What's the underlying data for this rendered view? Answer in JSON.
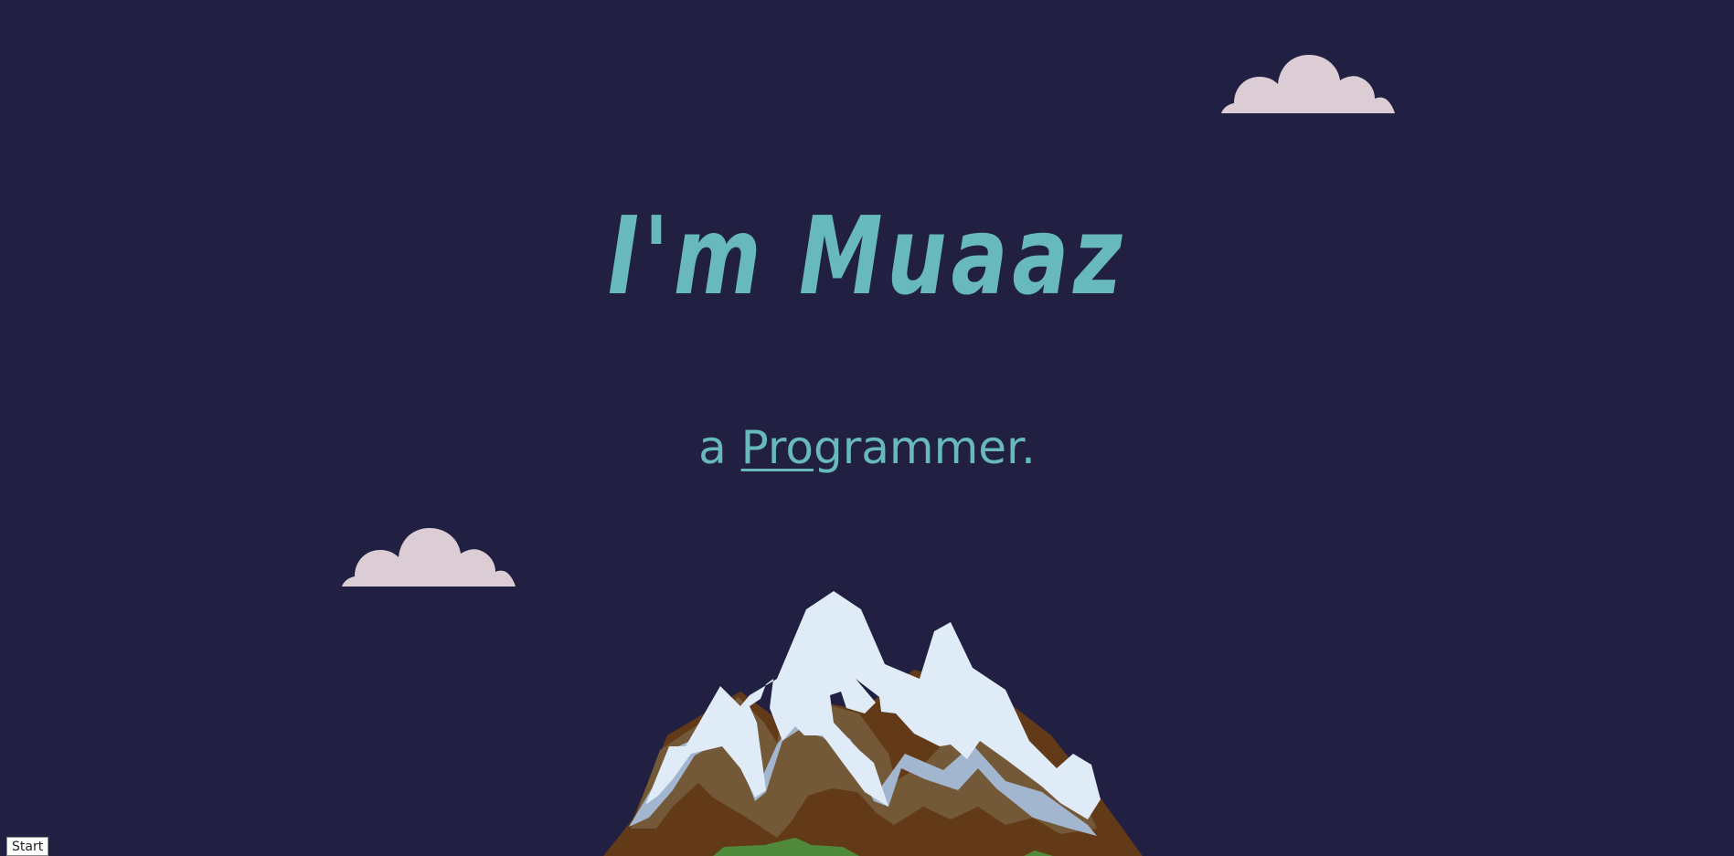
{
  "hero": {
    "title": "I'm Muaaz",
    "subtitle_prefix": "a ",
    "subtitle_typed": "Pro",
    "subtitle_rest": "grammer."
  },
  "controls": {
    "start_label": "Start"
  },
  "scene": {
    "icons": [
      "cloud-icon",
      "cloud-icon",
      "mountain-icon"
    ]
  },
  "colors": {
    "background": "#212042",
    "accent_text": "#67b9bd",
    "cloud": "#dbcdd3",
    "snow": "#dfebf7",
    "snow_shadow": "#a3b6cf",
    "rock_light": "#735938",
    "rock_dark": "#633a18",
    "grass": "#4f8a3a"
  }
}
